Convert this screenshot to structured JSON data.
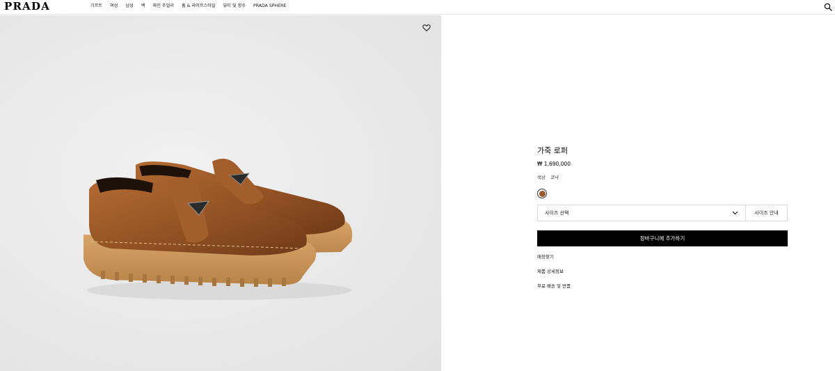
{
  "header": {
    "logo": "PRADA",
    "nav": [
      "기프트",
      "여성",
      "남성",
      "백",
      "파인 주얼리",
      "홈 & 라이프스타일",
      "뷰티 및 향수",
      "PRADA SPHERE"
    ]
  },
  "product": {
    "title": "가죽 로퍼",
    "price": "₩ 1,690,000",
    "color_label": "색상",
    "color_value": "코냑",
    "swatch_color": "#9a5a2b",
    "size_select": "사이즈 선택",
    "size_guide": "사이즈 안내",
    "add_to_cart": "장바구니에 추가하기",
    "links": [
      "매장찾기",
      "제품 상세정보",
      "무료 배송 및 반품"
    ]
  },
  "icons": {
    "search": "search-icon",
    "wishlist": "heart-icon",
    "dropdown": "chevron-down-icon"
  }
}
